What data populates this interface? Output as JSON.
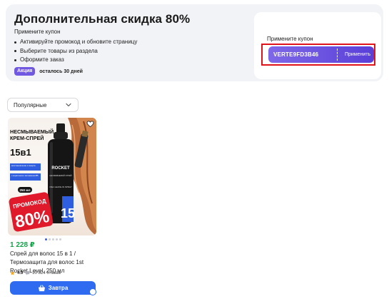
{
  "promo": {
    "title": "Дополнительная скидка 80%",
    "subtitle": "Примените купон",
    "steps": [
      "Активируйте промокод и обновите страницу",
      "Выберите товары из раздела",
      "Оформите заказ"
    ],
    "badge": "Акция",
    "days_left": "осталось 30 дней",
    "coupon_label": "Примените купон",
    "coupon_code": "VERTE9FD3B46",
    "apply_label": "Применить",
    "accent_color": "#6a52e0",
    "highlight_color": "#e0131b"
  },
  "sort": {
    "label": "Популярные",
    "icon": "chevron-down-icon"
  },
  "product": {
    "image_text": {
      "headline1": "НЕСМЫВАЕМЫЙ",
      "headline2": "КРЕМ-СПРЕЙ",
      "multi": "15в1",
      "feature1": "восстановление и защита",
      "feature2": "с кератином и витамином В5",
      "volume": "250 мл",
      "promo_word": "ПРОМОКОД",
      "promo_percent": "80%",
      "brand": "ROCKET",
      "bottle_label": "НЕСМЫВАЕМЫЙ СПРЕЙ",
      "bottle_sub": "15в1 LEAVE-IN SPRAY",
      "bottle_number": "15"
    },
    "price": "1 228 ₽",
    "name": "Спрей для волос 15 в 1 / Термозащита для волос 1st Rocket Level, 250 мл",
    "rating": "4.9",
    "reviews": "20 824 отзыва",
    "buy_label": "Завтра",
    "price_color": "#16a34a",
    "button_color": "#2f6bf0"
  }
}
